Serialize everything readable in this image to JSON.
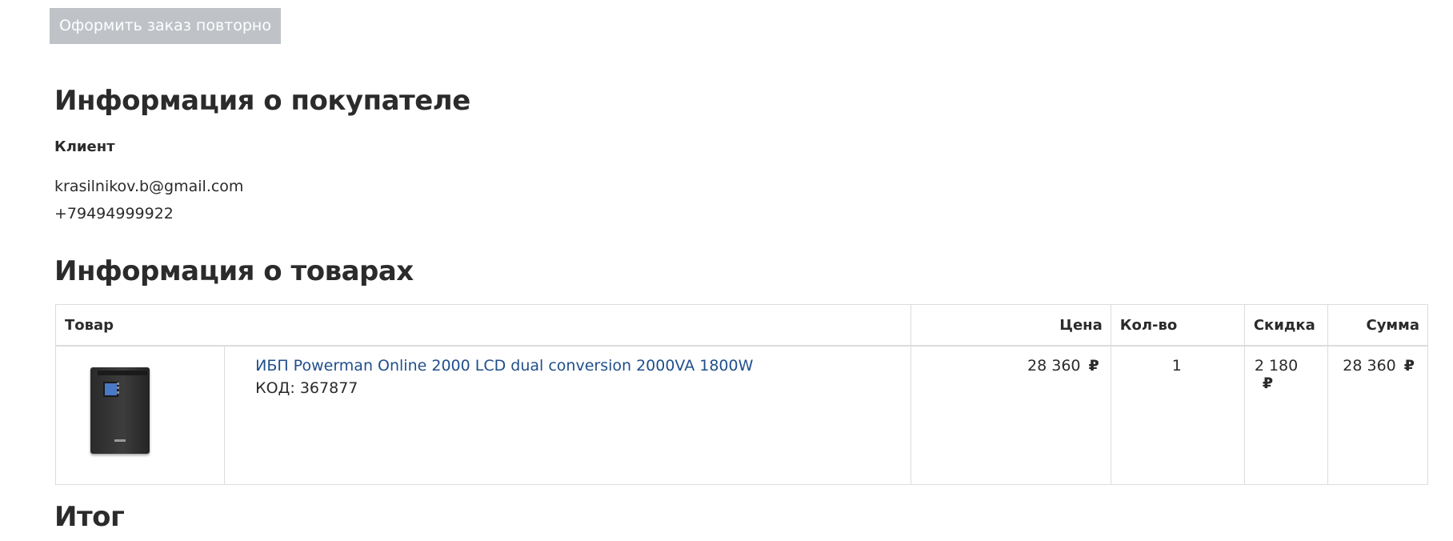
{
  "actions": {
    "reorder_label": "Оформить заказ повторно"
  },
  "buyer": {
    "heading": "Информация о покупателе",
    "client_label": "Клиент",
    "email": "krasilnikov.b@gmail.com",
    "phone": "+79494999922"
  },
  "products": {
    "heading": "Информация о товарах",
    "columns": {
      "product": "Товар",
      "price": "Цена",
      "qty": "Кол-во",
      "discount": "Скидка",
      "sum": "Сумма"
    },
    "currency_symbol": "₽",
    "items": [
      {
        "name": "ИБП Powerman Online 2000 LCD dual conversion 2000VA 1800W",
        "code": "КОД: 367877",
        "price": "28 360",
        "qty": "1",
        "discount": "2 180",
        "sum": "28 360",
        "image_icon": "ups-device-image"
      }
    ]
  },
  "total": {
    "heading": "Итог"
  },
  "colors": {
    "button_bg": "#bfc3c8",
    "link": "#1f4f8c",
    "text": "#2b2b2b",
    "border": "#dcdcdc"
  }
}
